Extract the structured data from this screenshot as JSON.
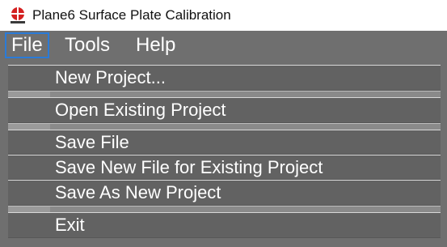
{
  "window": {
    "title": "Plane6 Surface Plate Calibration",
    "icon": "app-logo-icon"
  },
  "menubar": {
    "items": [
      {
        "label": "File",
        "active": true
      },
      {
        "label": "Tools"
      },
      {
        "label": "Help"
      }
    ]
  },
  "file_menu": {
    "items": [
      {
        "label": "New Project..."
      },
      {
        "label": "Open Existing Project"
      },
      {
        "label": "Save File"
      },
      {
        "label": "Save New File for Existing Project"
      },
      {
        "label": "Save As New Project"
      },
      {
        "label": "Exit"
      }
    ]
  },
  "colors": {
    "menu_background": "#6f6f6f",
    "menu_item_background": "#626262",
    "active_border": "#2a7bd8",
    "logo_red": "#d42020"
  }
}
